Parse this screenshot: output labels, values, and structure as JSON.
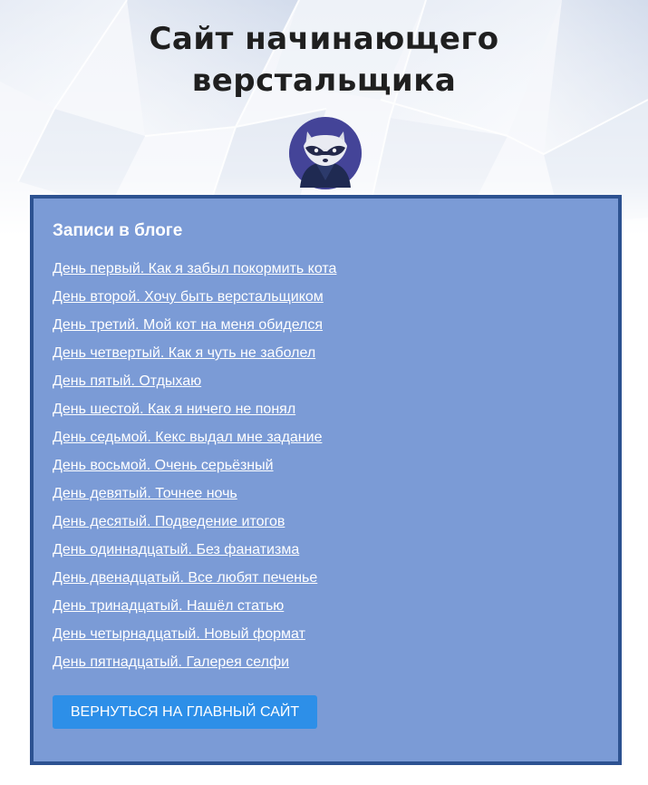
{
  "header": {
    "title_line1": "Сайт начинающего",
    "title_line2": "верстальщика",
    "avatar_icon": "raccoon-avatar-icon"
  },
  "blog": {
    "heading": "Записи в блоге",
    "posts": [
      "День первый. Как я забыл покормить кота",
      "День второй. Хочу быть верстальщиком",
      "День третий. Мой кот на меня обиделся",
      "День четвертый. Как я чуть не заболел",
      "День пятый. Отдыхаю",
      "День шестой. Как я ничего не понял",
      "День седьмой. Кекс выдал мне задание",
      "День восьмой. Очень серьёзный",
      "День девятый. Точнее ночь",
      "День десятый. Подведение итогов",
      "День одиннадцатый. Без фанатизма",
      "День двенадцатый. Все любят печенье",
      "День тринадцатый. Нашёл статью",
      "День четырнадцатый. Новый формат",
      "День пятнадцатый. Галерея селфи"
    ],
    "back_button": "ВЕРНУТЬСЯ НА ГЛАВНЫЙ САЙТ"
  },
  "colors": {
    "panel_bg": "#7b9bd6",
    "panel_border": "#2d5291",
    "button_bg": "#2d8fe8",
    "link_text": "#ffffff"
  }
}
